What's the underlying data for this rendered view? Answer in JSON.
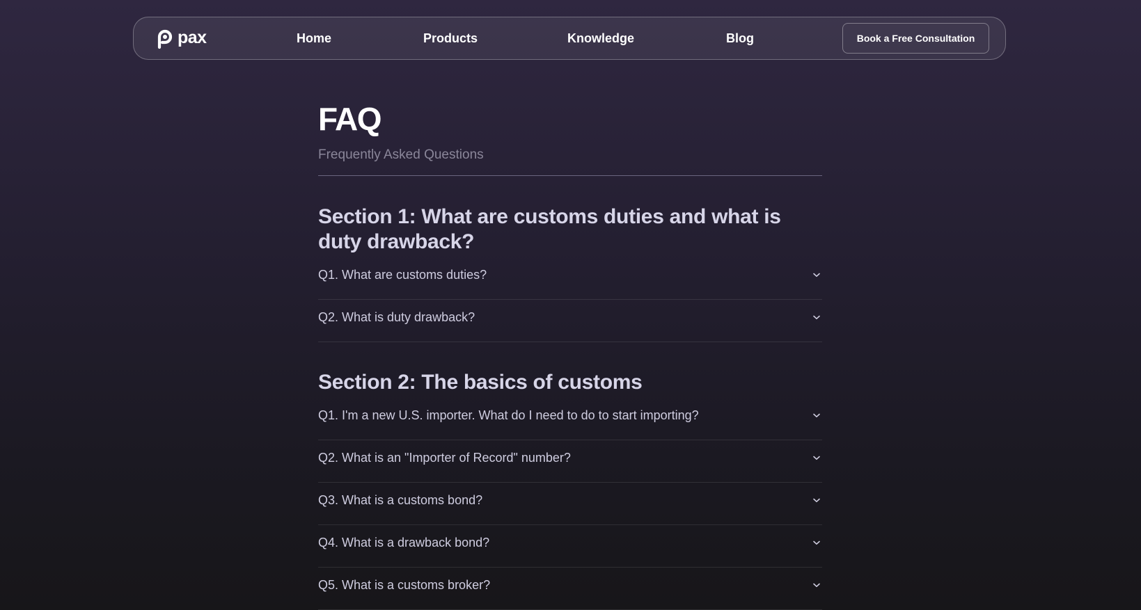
{
  "header": {
    "logo_text": "pax",
    "nav": {
      "home": "Home",
      "products": "Products",
      "knowledge": "Knowledge",
      "blog": "Blog"
    },
    "cta_label": "Book a Free Consultation"
  },
  "page": {
    "title": "FAQ",
    "subtitle": "Frequently Asked Questions"
  },
  "sections": [
    {
      "heading": "Section 1: What are customs duties and what is duty drawback?",
      "questions": [
        "Q1. What are customs duties?",
        "Q2. What is duty drawback?"
      ]
    },
    {
      "heading": "Section 2: The basics of customs",
      "questions": [
        "Q1. I'm a new U.S. importer. What do I need to do to start importing?",
        "Q2. What is an \"Importer of Record\" number?",
        "Q3. What is a customs bond?",
        "Q4. What is a drawback bond?",
        "Q5. What is a customs broker?"
      ]
    }
  ],
  "icons": {
    "logo": "pax-logo-icon",
    "expand": "chevron-down-icon"
  },
  "colors": {
    "background_top": "#2f2740",
    "background_bottom": "#171619",
    "heading": "#d7d5e8",
    "subtitle": "#8a8699"
  }
}
